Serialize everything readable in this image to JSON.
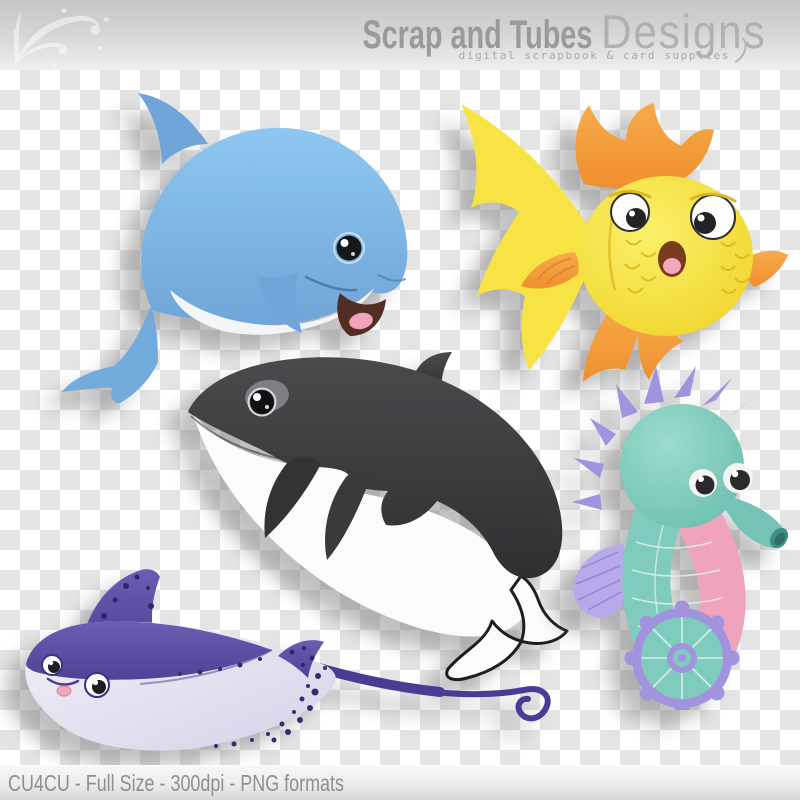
{
  "header": {
    "brand_bold": "Scrap and Tubes",
    "brand_light": "Designs",
    "tagline": "digital scrapbook & card supplies"
  },
  "footer": {
    "info": "CU4CU - Full Size - 300dpi - PNG formats"
  },
  "illustrations": [
    {
      "name": "dolphin",
      "label": "blue dolphin clipart",
      "primary_color": "#7fb6e6"
    },
    {
      "name": "goldfish",
      "label": "yellow goldfish clipart",
      "primary_color": "#f7e33d",
      "accent_color": "#f5a03e"
    },
    {
      "name": "orca",
      "label": "orca whale clipart",
      "primary_color": "#3b3b3e"
    },
    {
      "name": "seahorse",
      "label": "teal seahorse clipart",
      "primary_color": "#7fcbbd",
      "accent_color": "#a293de"
    },
    {
      "name": "stingray",
      "label": "purple stingray clipart",
      "primary_color": "#5b4ea0"
    }
  ],
  "palette": {
    "header_gray_top": "#c6c6c6",
    "header_gray_bottom": "#efefef",
    "title_gray": "#9a9a9a",
    "title_light_gray": "#b1b1b1",
    "tagline_gray": "#a9a9a9",
    "checker_gray": "#e4e4e4",
    "checker_white": "#ffffff",
    "footer_text_gray": "#8f8f8f"
  }
}
